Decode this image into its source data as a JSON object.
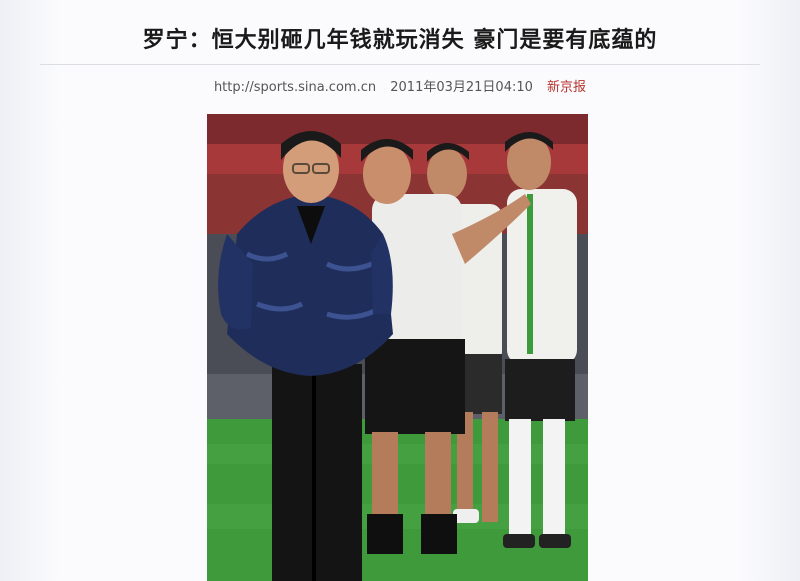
{
  "article": {
    "headline": "罗宁：恒大别砸几年钱就玩消失  豪门是要有底蕴的",
    "source_url": "http://sports.sina.com.cn",
    "datetime": "2011年03月21日04:10",
    "publisher": "新京报"
  },
  "colors": {
    "publisher": "#b5332e",
    "pitch": "#3f9a3c",
    "jacket": "#1f2d5a"
  }
}
